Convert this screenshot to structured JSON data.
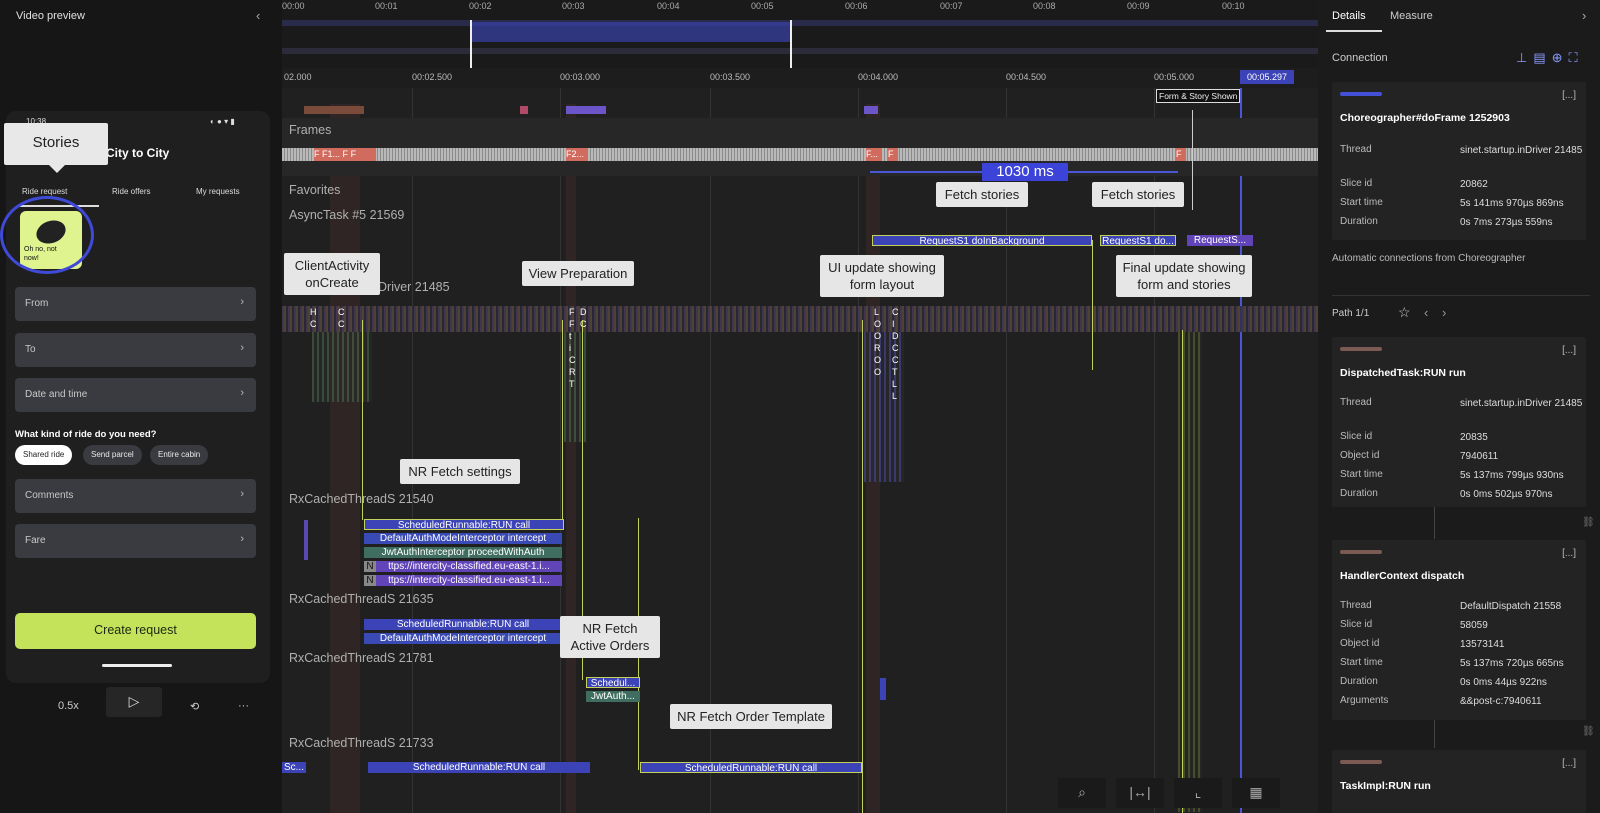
{
  "left_panel": {
    "title": "Video preview",
    "collapse_icon": "chevron-left-icon",
    "phone": {
      "status_time": "10:38",
      "app_title": "City to City",
      "tabs": [
        "Ride request",
        "Ride offers",
        "My requests"
      ],
      "story_text": "Oh no, not now!",
      "fields": [
        "From",
        "To",
        "Date and time",
        "Comments",
        "Fare"
      ],
      "question": "What kind of ride do you need?",
      "chips": [
        "Shared ride",
        "Send parcel",
        "Entire cabin"
      ],
      "create_button": "Create request"
    },
    "callout": "Stories",
    "playback": {
      "speed": "0.5x",
      "play_icon": "play-icon",
      "loop_icon": "loop-icon",
      "more_icon": "more-icon"
    }
  },
  "timeline": {
    "overview_ticks": [
      "00:00",
      "00:01",
      "00:02",
      "00:03",
      "00:04",
      "00:05",
      "00:06",
      "00:07",
      "00:08",
      "00:09",
      "00:10"
    ],
    "zoom_ticks": [
      "02.000",
      "00:02.500",
      "00:03.000",
      "00:03.500",
      "00:04.000",
      "00:04.500",
      "00:05.000"
    ],
    "cursor_label": "00:05.297",
    "marker_label": "Form & Story Shown",
    "tracks": {
      "frames": "Frames",
      "favorites": "Favorites",
      "async": "AsyncTask #5 21569",
      "main_thread": "Driver 21485",
      "rx1": "RxCachedThreadS 21540",
      "rx2": "RxCachedThreadS 21635",
      "rx3": "RxCachedThreadS 21781",
      "rx4": "RxCachedThreadS 21733"
    },
    "frame_labels": [
      "F",
      "F1...",
      "F",
      "F",
      "F2...",
      "F...",
      "F",
      "F"
    ],
    "measure": "1030 ms",
    "callouts": {
      "client": "ClientActivity onCreate",
      "view_prep": "View Preparation",
      "ui_update": "UI update showing form layout",
      "fetch1": "Fetch stories",
      "fetch2": "Fetch stories",
      "final_update": "Final update showing form and stories",
      "nr_settings": "NR Fetch settings",
      "nr_active": "NR Fetch Active Orders",
      "nr_template": "NR Fetch Order Template"
    },
    "slices": {
      "req1": "RequestS1 doInBackground",
      "req2": "RequestS1 do...",
      "req3": "RequestS...",
      "sched1": "ScheduledRunnable:RUN call",
      "auth1": "DefaultAuthModeInterceptor intercept",
      "jwt1": "JwtAuthInterceptor proceedWithAuth",
      "https1": "ttps://intercity-classified.eu-east-1.i...",
      "https2": "ttps://intercity-classified.eu-east-1.i...",
      "n_label": "N",
      "sched2": "ScheduledRunnable:RUN call",
      "auth2": "DefaultAuthModeInterceptor intercept",
      "sched3": "Schedul...",
      "jwt3": "JwtAuth...",
      "sc": "Sc...",
      "sched4": "ScheduledRunnable:RUN call",
      "sched5": "ScheduledRunnable:RUN call"
    },
    "main_thread_letters": {
      "a": [
        "H",
        "C"
      ],
      "b": [
        "C",
        "C"
      ],
      "c": [
        "F",
        "F",
        "t",
        "i",
        "C",
        "R",
        "T"
      ],
      "d": [
        "D",
        "C"
      ],
      "e": [
        "L",
        "O",
        "O",
        "R",
        "O",
        "O"
      ],
      "f": [
        "C",
        "I",
        "D",
        "C",
        "C",
        "T",
        "L",
        "L"
      ]
    },
    "toolbar_icons": [
      "search-icon",
      "fit-range-icon",
      "crop-icon",
      "view-icon"
    ]
  },
  "details": {
    "tabs": [
      "Details",
      "Measure"
    ],
    "section": "Connection",
    "auto_text": "Automatic connections from Choreographer",
    "path": "Path 1/1",
    "cards": [
      {
        "title": "Choreographer#doFrame 1252903",
        "bar_color": "#4450d8",
        "rows": [
          [
            "Thread",
            "sinet.startup.inDriver 21485"
          ],
          [
            "Slice id",
            "20862"
          ],
          [
            "Start time",
            "5s 141ms 970µs 869ns"
          ],
          [
            "Duration",
            "0s 7ms 273µs 559ns"
          ]
        ]
      },
      {
        "title": "DispatchedTask:RUN run",
        "bar_color": "#7a5a52",
        "rows": [
          [
            "Thread",
            "sinet.startup.inDriver 21485"
          ],
          [
            "Slice id",
            "20835"
          ],
          [
            "Object id",
            "7940611"
          ],
          [
            "Start time",
            "5s 137ms 799µs 930ns"
          ],
          [
            "Duration",
            "0s 0ms 502µs 970ns"
          ]
        ]
      },
      {
        "title": "HandlerContext dispatch",
        "bar_color": "#7a5a52",
        "rows": [
          [
            "Thread",
            "DefaultDispatch 21558"
          ],
          [
            "Slice id",
            "58059"
          ],
          [
            "Object id",
            "13573141"
          ],
          [
            "Start time",
            "5s 137ms 720µs 665ns"
          ],
          [
            "Duration",
            "0s 0ms 44µs 922ns"
          ],
          [
            "Arguments",
            "&&post-c:7940611"
          ]
        ]
      },
      {
        "title": "TaskImpl:RUN run",
        "bar_color": "#7a5a52",
        "rows": []
      }
    ],
    "dots": "[...]"
  }
}
